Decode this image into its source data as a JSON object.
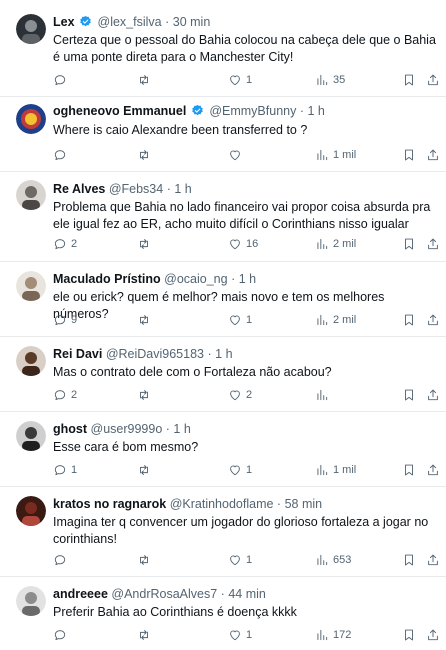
{
  "posts": [
    {
      "name": "Lex",
      "verified": true,
      "handle": "@lex_fsilva",
      "dot": "·",
      "time": "30 min",
      "text": "Certeza que o pessoal do Bahia colocou na cabeça dele que o Bahia é uma ponte direta para o Manchester City!",
      "replies": "",
      "reposts": "",
      "likes": "1",
      "views": "35",
      "avatar_color": "#2b3136"
    },
    {
      "name": "ogheneovo Emmanuel",
      "verified": true,
      "handle": "@EmmyBfunny",
      "dot": "·",
      "time": "1 h",
      "text": "Where is caio Alexandre been transferred to ?",
      "replies": "",
      "reposts": "",
      "likes": "",
      "views": "1 mil",
      "avatar_color": "#1e3f8a"
    },
    {
      "name": "Re Alves",
      "verified": false,
      "handle": "@Febs34",
      "dot": "·",
      "time": "1 h",
      "text": "Problema que Bahia no lado financeiro vai propor coisa absurda pra ele igual fez ao ER, acho muito difícil o Corinthians nisso igualar",
      "replies": "2",
      "reposts": "",
      "likes": "16",
      "views": "2 mil",
      "avatar_color": "#6d6a66"
    },
    {
      "name": "Maculado Prístino",
      "verified": false,
      "handle": "@ocaio_ng",
      "dot": "·",
      "time": "1 h",
      "text": "ele ou erick? quem é melhor? mais novo e tem os melhores números?",
      "replies": "9",
      "reposts": "",
      "likes": "1",
      "views": "2 mil",
      "avatar_color": "#a38c78"
    },
    {
      "name": "Rei Davi",
      "verified": false,
      "handle": "@ReiDavi965183",
      "dot": "·",
      "time": "1 h",
      "text": "Mas o contrato dele com o Fortaleza não acabou?",
      "replies": "2",
      "reposts": "",
      "likes": "2",
      "views": "",
      "avatar_color": "#5a3a26"
    },
    {
      "name": "ghost",
      "verified": false,
      "handle": "@user9999o",
      "dot": "·",
      "time": "1 h",
      "text": "Esse cara é bom mesmo?",
      "replies": "1",
      "reposts": "",
      "likes": "1",
      "views": "1 mil",
      "avatar_color": "#3a3a3a"
    },
    {
      "name": "kratos no ragnarok",
      "verified": false,
      "handle": "@Kratinhodoflame",
      "dot": "·",
      "time": "58 min",
      "text": "Imagina ter q convencer um jogador do glorioso fortaleza a jogar no corinthians!",
      "replies": "",
      "reposts": "",
      "likes": "1",
      "views": "653",
      "avatar_color": "#7a2a1e"
    },
    {
      "name": "andreeee",
      "verified": false,
      "handle": "@AndrRosaAlves7",
      "dot": "·",
      "time": "44 min",
      "text": "Preferir Bahia ao Corinthians é doença kkkk",
      "replies": "",
      "reposts": "",
      "likes": "1",
      "views": "172",
      "avatar_color": "#8c8c8c"
    }
  ],
  "icons": {
    "reply": "reply-icon",
    "repost": "repost-icon",
    "like": "heart-icon",
    "views": "views-icon",
    "bookmark": "bookmark-icon",
    "share": "share-icon",
    "verified": "verified-badge-icon"
  },
  "colors": {
    "text": "#0f1419",
    "secondary": "#536471",
    "verified": "#1d9bf0",
    "divider": "#e7e9ea"
  }
}
